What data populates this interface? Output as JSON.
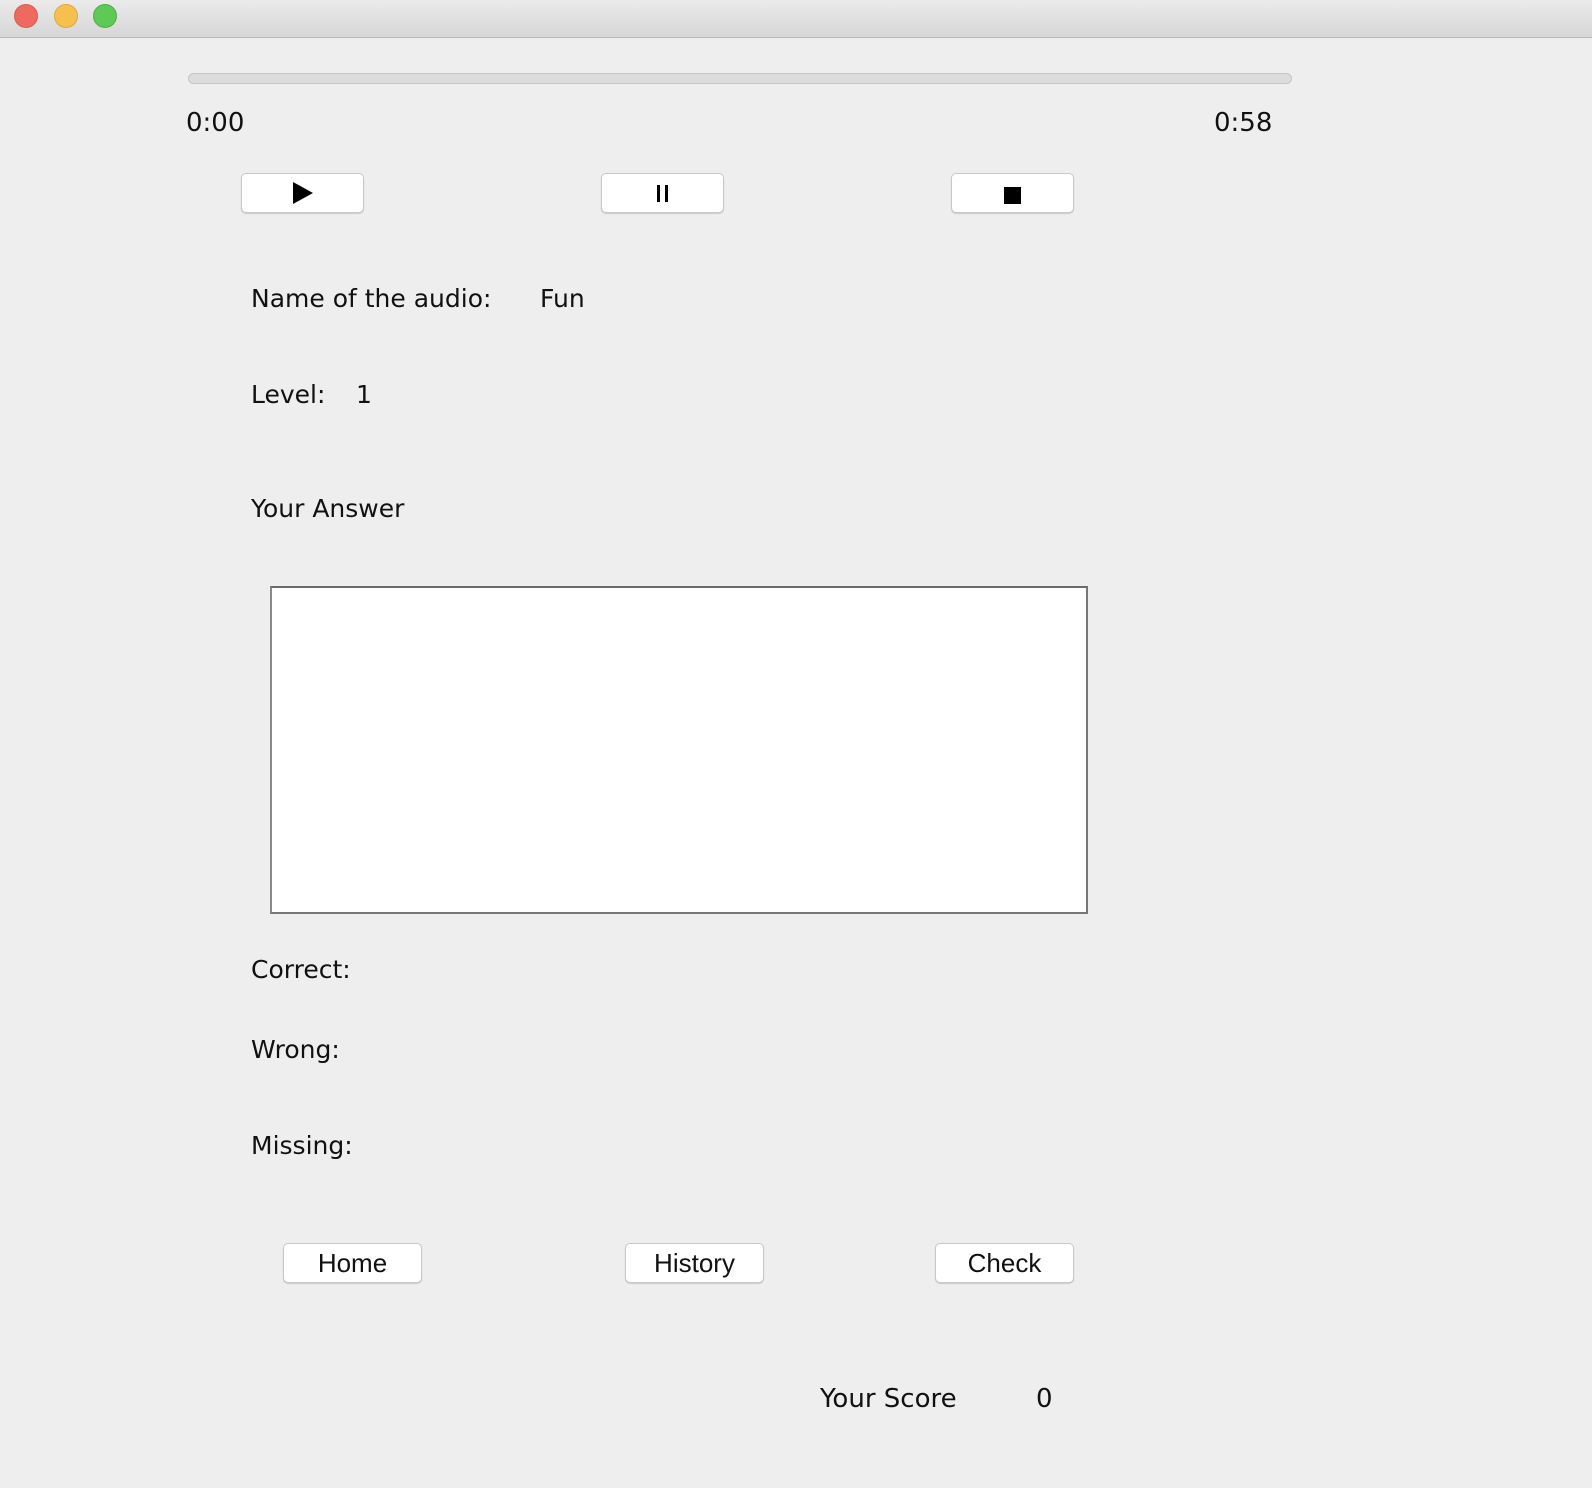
{
  "window": {
    "controls": [
      "close",
      "minimize",
      "maximize"
    ]
  },
  "player": {
    "progress_fraction": 0,
    "current_time": "0:00",
    "total_time": "0:58",
    "buttons": {
      "play_icon": "play-icon",
      "pause_icon": "pause-icon",
      "stop_icon": "stop-icon"
    }
  },
  "info": {
    "audio_name_label": "Name of the audio:",
    "audio_name_value": "Fun",
    "level_label": "Level:",
    "level_value": "1"
  },
  "answer": {
    "heading": "Your Answer",
    "value": "",
    "placeholder": ""
  },
  "results": {
    "correct_label": "Correct:",
    "correct_value": "",
    "wrong_label": "Wrong:",
    "wrong_value": "",
    "missing_label": "Missing:",
    "missing_value": ""
  },
  "actions": {
    "home": "Home",
    "history": "History",
    "check": "Check"
  },
  "score": {
    "label": "Your Score",
    "value": "0"
  }
}
